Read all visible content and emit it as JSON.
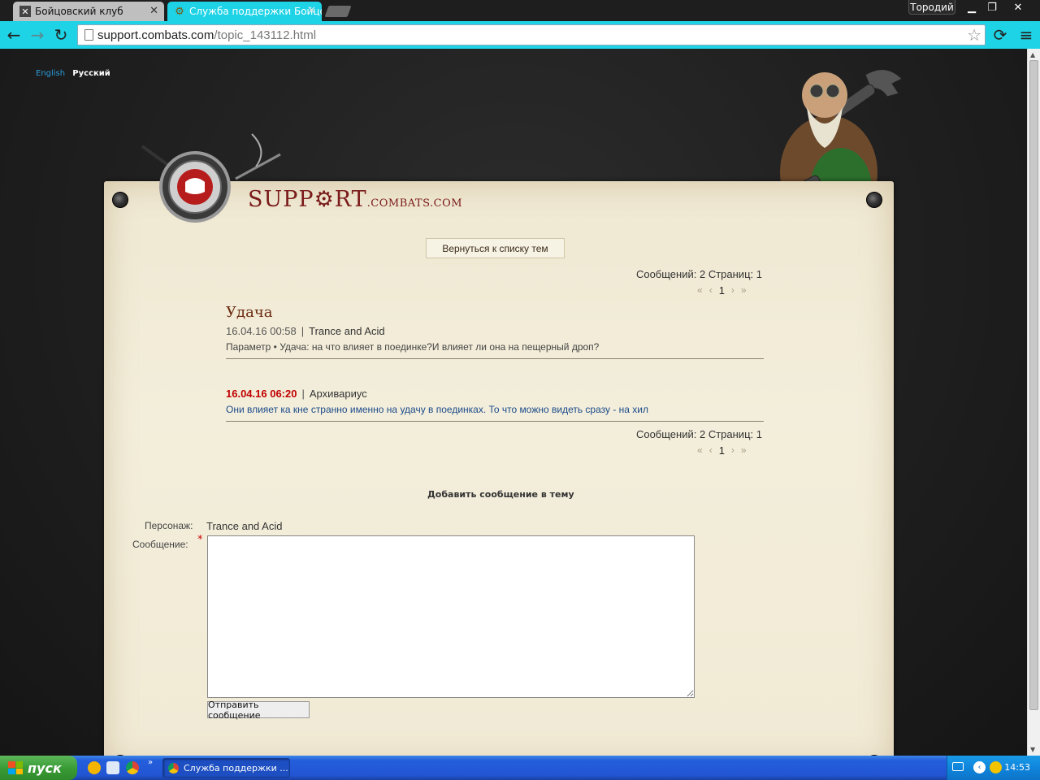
{
  "browser": {
    "tabs": [
      {
        "label": "Бойцовский клуб",
        "active": false
      },
      {
        "label": "Служба поддержки Бойцо",
        "active": true
      }
    ],
    "profile_name": "Тородий",
    "url_host": "support.combats.com",
    "url_path": "/topic_143112.html",
    "colors": {
      "frame": "#1ed3e6"
    }
  },
  "page": {
    "languages": {
      "english": "English",
      "russian": "Русский"
    },
    "logo": {
      "main": "SUPP⚙RT",
      "domain": ".COMBATS.COM"
    },
    "back_button": "Вернуться к списку тем",
    "stats_top": {
      "messages_label": "Сообщений:",
      "messages": "2",
      "pages_label": "Страниц:",
      "pages": "1"
    },
    "stats_bottom": {
      "messages_label": "Сообщений:",
      "messages": "2",
      "pages_label": "Страниц:",
      "pages": "1"
    },
    "pager": {
      "first": "«",
      "prev": "‹",
      "current": "1",
      "next": "›",
      "last": "»"
    },
    "topic": {
      "title": "Удача",
      "date": "16.04.16 00:58",
      "separator": "|",
      "author": "Trance and Acid",
      "text": "Параметр • Удача: на что влияет в поединке?И влияет ли она на пещерный дроп?"
    },
    "reply": {
      "date": "16.04.16 06:20",
      "separator": "|",
      "author": "Архивариус",
      "text": "Они влияет ка кне странно именно на удачу в поединках. То что можно видеть сразу - на хил"
    },
    "form": {
      "title": "Добавить сообщение в тему",
      "character_label": "Персонаж:",
      "character_value": "Trance and Acid",
      "message_label": "Сообщение:",
      "required_mark": "*",
      "message_value": "",
      "submit": "Отправить сообщение"
    }
  },
  "taskbar": {
    "start_label": "пуск",
    "task_label": "Служба поддержки ...",
    "clock": "14:53"
  }
}
